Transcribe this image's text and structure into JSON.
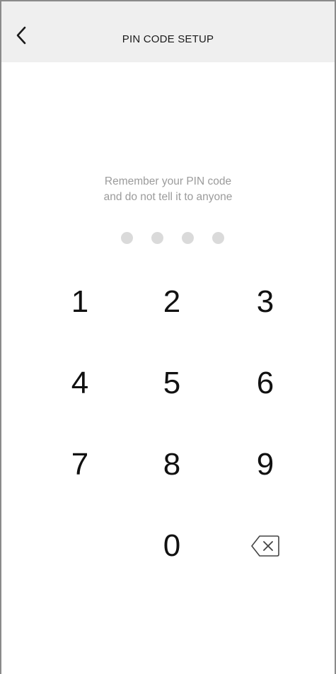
{
  "header": {
    "title": "PIN CODE SETUP",
    "back_icon": "chevron-left-icon"
  },
  "hint": {
    "line1": "Remember your PIN code",
    "line2": "and do not tell it to anyone"
  },
  "pin": {
    "length": 4,
    "entered": 0
  },
  "keypad": {
    "keys": [
      "1",
      "2",
      "3",
      "4",
      "5",
      "6",
      "7",
      "8",
      "9",
      "0"
    ],
    "backspace_icon": "backspace-icon"
  },
  "colors": {
    "header_bg": "#efefef",
    "hint_text": "#9b9b9b",
    "dot_empty": "#dadada",
    "key_text": "#111111"
  }
}
